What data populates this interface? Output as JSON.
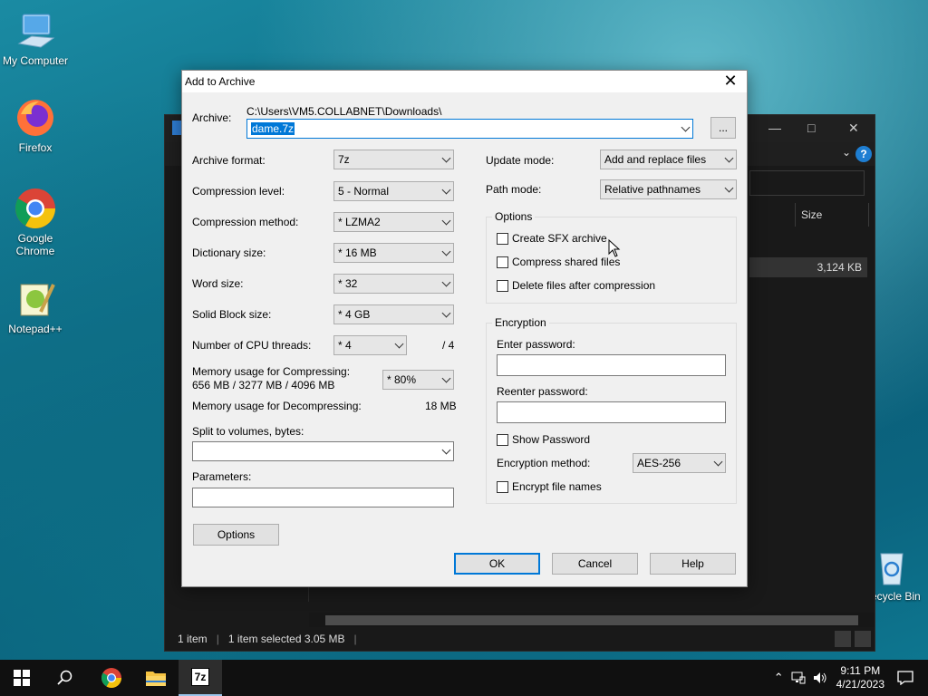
{
  "desktop": {
    "icons": [
      {
        "label": "My Computer"
      },
      {
        "label": "Firefox"
      },
      {
        "label": "Google Chrome"
      },
      {
        "label": "Notepad++"
      },
      {
        "label": "Recycle Bin"
      }
    ]
  },
  "explorer": {
    "column_size": "Size",
    "file_size": "3,124 KB",
    "status_items": "1 item",
    "status_selected": "1 item selected  3.05 MB"
  },
  "dialog": {
    "title": "Add to Archive",
    "archive_label": "Archive:",
    "archive_path": "C:\\Users\\VM5.COLLABNET\\Downloads\\",
    "archive_name": "dame.7z",
    "browse_label": "...",
    "left": {
      "archive_format": {
        "label": "Archive format:",
        "value": "7z"
      },
      "compression_level": {
        "label": "Compression level:",
        "value": "5 - Normal"
      },
      "compression_method": {
        "label": "Compression method:",
        "value": "* LZMA2"
      },
      "dictionary_size": {
        "label": "Dictionary size:",
        "value": "* 16 MB"
      },
      "word_size": {
        "label": "Word size:",
        "value": "* 32"
      },
      "solid_block": {
        "label": "Solid Block size:",
        "value": "* 4 GB"
      },
      "cpu_threads": {
        "label": "Number of CPU threads:",
        "value": "* 4",
        "max": "/ 4"
      },
      "mem_compress_label": "Memory usage for Compressing:",
      "mem_compress_value": "656 MB / 3277 MB / 4096 MB",
      "mem_compress_pct": "* 80%",
      "mem_decompress_label": "Memory usage for Decompressing:",
      "mem_decompress_value": "18 MB",
      "split_label": "Split to volumes, bytes:",
      "split_value": "",
      "params_label": "Parameters:",
      "params_value": "",
      "options_button": "Options"
    },
    "right": {
      "update_mode": {
        "label": "Update mode:",
        "value": "Add and replace files"
      },
      "path_mode": {
        "label": "Path mode:",
        "value": "Relative pathnames"
      },
      "options_group": "Options",
      "opt_sfx": "Create SFX archive",
      "opt_shared": "Compress shared files",
      "opt_delete": "Delete files after compression",
      "encryption_group": "Encryption",
      "enter_password": "Enter password:",
      "reenter_password": "Reenter password:",
      "show_password": "Show Password",
      "enc_method_label": "Encryption method:",
      "enc_method_value": "AES-256",
      "encrypt_names": "Encrypt file names"
    },
    "buttons": {
      "ok": "OK",
      "cancel": "Cancel",
      "help": "Help"
    }
  },
  "taskbar": {
    "time": "9:11 PM",
    "date": "4/21/2023",
    "app_7z": "7z"
  }
}
